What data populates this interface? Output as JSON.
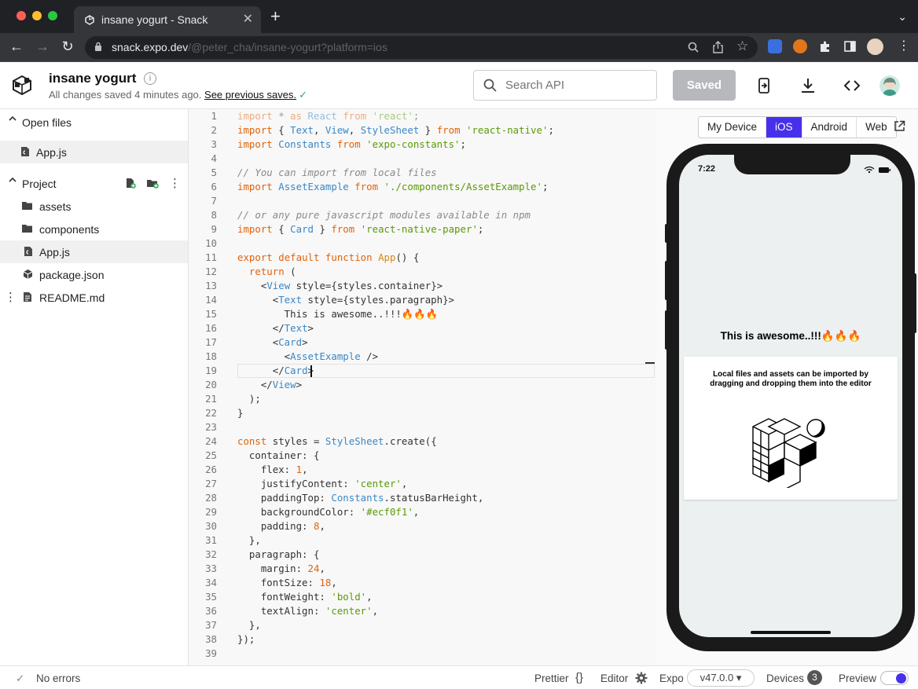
{
  "browser": {
    "tab_title": "insane yogurt - Snack",
    "new_tab": "+",
    "tab_close": "✕",
    "url_host": "snack.expo.dev",
    "url_path": "/@peter_cha/insane-yogurt?platform=ios"
  },
  "header": {
    "project_name": "insane yogurt",
    "save_status": "All changes saved 4 minutes ago.",
    "previous_saves": "See previous saves.",
    "search_placeholder": "Search API",
    "saved_label": "Saved"
  },
  "sidebar": {
    "open_files_title": "Open files",
    "open_files": [
      "App.js"
    ],
    "project_title": "Project",
    "items": [
      {
        "label": "assets",
        "icon": "folder-icon"
      },
      {
        "label": "components",
        "icon": "folder-icon"
      },
      {
        "label": "App.js",
        "icon": "js-file-icon"
      },
      {
        "label": "package.json",
        "icon": "package-icon"
      },
      {
        "label": "README.md",
        "icon": "md-file-icon"
      }
    ]
  },
  "editor": {
    "lines": [
      "import * as React from 'react';",
      "import { Text, View, StyleSheet } from 'react-native';",
      "import Constants from 'expo-constants';",
      "",
      "// You can import from local files",
      "import AssetExample from './components/AssetExample';",
      "",
      "// or any pure javascript modules available in npm",
      "import { Card } from 'react-native-paper';",
      "",
      "export default function App() {",
      "  return (",
      "    <View style={styles.container}>",
      "      <Text style={styles.paragraph}>",
      "        This is awesome..!!!🔥🔥🔥",
      "      </Text>",
      "      <Card>",
      "        <AssetExample />",
      "      </Card>",
      "    </View>",
      "  );",
      "}",
      "",
      "const styles = StyleSheet.create({",
      "  container: {",
      "    flex: 1,",
      "    justifyContent: 'center',",
      "    paddingTop: Constants.statusBarHeight,",
      "    backgroundColor: '#ecf0f1',",
      "    padding: 8,",
      "  },",
      "  paragraph: {",
      "    margin: 24,",
      "    fontSize: 18,",
      "    fontWeight: 'bold',",
      "    textAlign: 'center',",
      "  },",
      "});",
      ""
    ]
  },
  "preview": {
    "platforms": [
      "My Device",
      "iOS",
      "Android",
      "Web"
    ],
    "selected_platform": "iOS",
    "time": "7:22",
    "paragraph": "This is awesome..!!!🔥🔥🔥",
    "card_text": "Local files and assets can be imported by dragging and dropping them into the editor",
    "background": "#ecf0f1"
  },
  "footer": {
    "errors": "No errors",
    "prettier": "Prettier",
    "prettier_icon": "{}",
    "editor": "Editor",
    "expo": "Expo",
    "expo_version": "v47.0.0 ▾",
    "devices": "Devices",
    "device_count": "3",
    "preview": "Preview"
  },
  "colors": {
    "accent": "#4630eb",
    "saved_button": "#b6b8bc",
    "keyword": "#e36209",
    "string": "#5a9a06",
    "tag": "#3a87c5"
  }
}
